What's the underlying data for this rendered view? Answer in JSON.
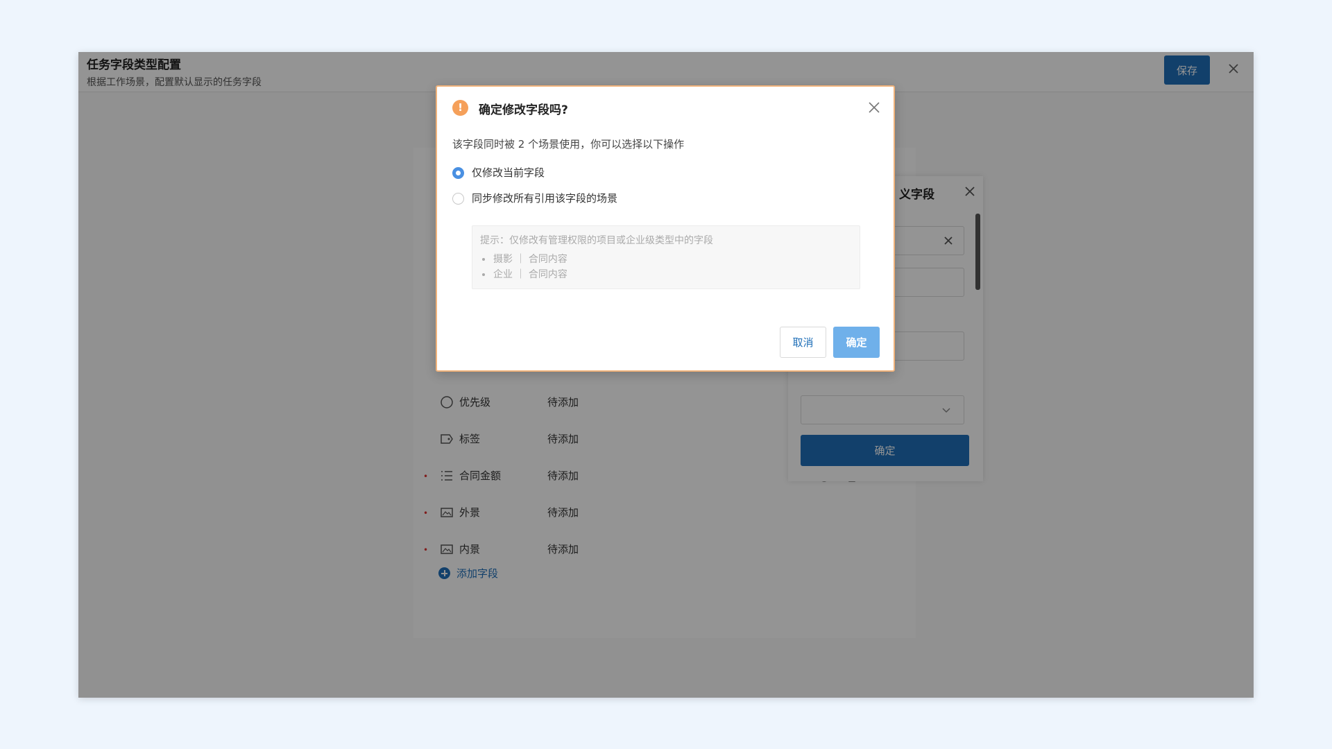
{
  "window": {
    "title": "任务字段类型配置",
    "subtitle": "根据工作场景，配置默认显示的任务字段",
    "save_label": "保存"
  },
  "fields": [
    {
      "name": "优先级",
      "status": "待添加",
      "icon": "circle-icon"
    },
    {
      "name": "标签",
      "status": "待添加",
      "icon": "tag-icon"
    },
    {
      "name": "合同金额",
      "status": "待添加",
      "icon": "list-icon"
    },
    {
      "name": "外景",
      "status": "待添加",
      "icon": "image-icon"
    },
    {
      "name": "内景",
      "status": "待添加",
      "icon": "image-icon"
    }
  ],
  "add_field_label": "添加字段",
  "side_panel": {
    "title_visible": "义字段",
    "confirm_label": "确定"
  },
  "dialog": {
    "title": "确定修改字段吗?",
    "description": "该字段同时被 2 个场景使用，你可以选择以下操作",
    "options": [
      {
        "label": "仅修改当前字段",
        "checked": true
      },
      {
        "label": "同步修改所有引用该字段的场景",
        "checked": false
      }
    ],
    "hint_title": "提示：仅修改有管理权限的项目或企业级类型中的字段",
    "hint_items": [
      "摄影 ｜ 合同内容",
      "企业 ｜ 合同内容"
    ],
    "cancel_label": "取消",
    "ok_label": "确定"
  },
  "colors": {
    "primary": "#1f6fb8",
    "warning": "#f5a05a",
    "radio_checked": "#4a90e2"
  }
}
